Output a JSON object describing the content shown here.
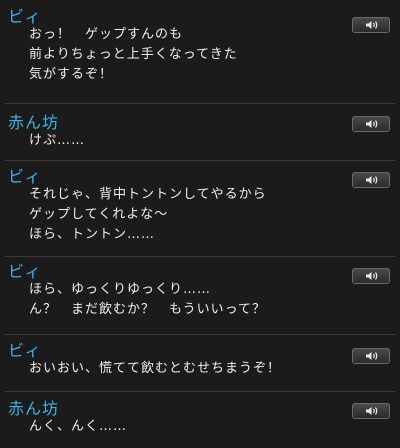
{
  "log": {
    "entries": [
      {
        "speaker": "ビィ",
        "lines": [
          "おっ！　ゲップすんのも",
          "前よりちょっと上手くなってきた",
          "気がするぞ！"
        ]
      },
      {
        "speaker": "赤ん坊",
        "lines": [
          "けぷ……"
        ]
      },
      {
        "speaker": "ビィ",
        "lines": [
          "それじゃ、背中トントンしてやるから",
          "ゲップしてくれよな～",
          "ほら、トントン……"
        ]
      },
      {
        "speaker": "ビィ",
        "lines": [
          "ほら、ゆっくりゆっくり……",
          "ん？　まだ飲むか？　もういいって？"
        ]
      },
      {
        "speaker": "ビィ",
        "lines": [
          "おいおい、慌てて飲むとむせちまうぞ！"
        ]
      },
      {
        "speaker": "赤ん坊",
        "lines": [
          "んく、んく……"
        ]
      }
    ]
  },
  "icons": {
    "voice": "speaker-icon"
  },
  "colors": {
    "speaker_name": "#3fb3e8",
    "dialogue_text": "#f0f0f0",
    "background": "#1b1b1b"
  }
}
